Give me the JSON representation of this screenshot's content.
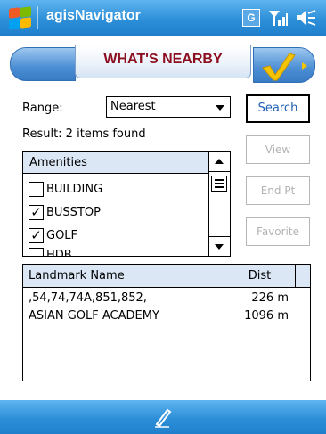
{
  "titlebar": {
    "app_title": "agisNavigator",
    "signal_badge": "G",
    "start_icon": "windows-start-icon",
    "signal_icon": "signal-icon",
    "volume_icon": "speaker-icon"
  },
  "header": {
    "title": "WHAT'S NEARBY",
    "ok_icon": "checkmark-icon"
  },
  "form": {
    "range_label": "Range:",
    "range_value": "Nearest",
    "result_text": "Result: 2 items found"
  },
  "buttons": {
    "search": "Search",
    "view": "View",
    "end_pt": "End Pt",
    "favorite": "Favorite"
  },
  "amenities": {
    "header": "Amenities",
    "items": [
      {
        "label": "BUILDING",
        "checked": false,
        "mark": ""
      },
      {
        "label": "BUSSTOP",
        "checked": true,
        "mark": "✓"
      },
      {
        "label": "GOLF",
        "checked": true,
        "mark": "✓"
      },
      {
        "label": "HDB",
        "checked": false,
        "mark": ""
      }
    ]
  },
  "results": {
    "columns": [
      "Landmark Name",
      "Dist"
    ],
    "rows": [
      {
        "name": ",54,74,74A,851,852,",
        "dist": "226 m"
      },
      {
        "name": "ASIAN GOLF ACADEMY",
        "dist": "1096 m"
      }
    ]
  },
  "bottombar": {
    "input_icon": "pen-icon"
  },
  "colors": {
    "bar_blue": "#2d8fd8",
    "title_red": "#8b0d1e",
    "search_blue": "#1e5fb4",
    "disabled_gray": "#b3b3b3",
    "header_fill": "#dbe7f5"
  }
}
